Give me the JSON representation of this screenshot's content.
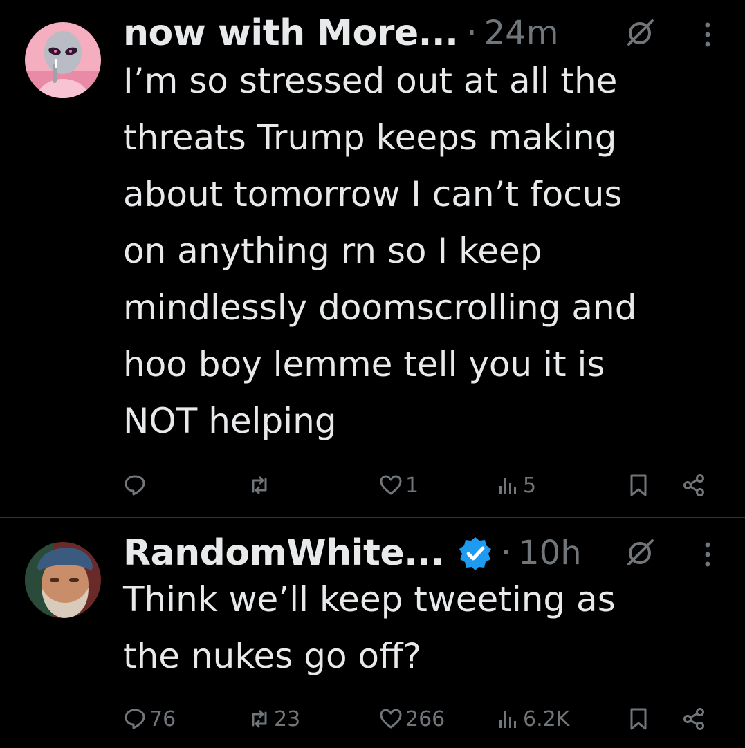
{
  "colors": {
    "background": "#000000",
    "text_primary": "#e7e9ea",
    "text_secondary": "#71767b",
    "divider": "#2f3336",
    "verified_blue": "#1d9bf0"
  },
  "tweets": [
    {
      "display_name": "now with More...",
      "separator": "·",
      "time": "24m",
      "verified": false,
      "avatar_icon": "alien-avatar",
      "text": "I’m so stressed out at all the\nthreats Trump keeps making\nabout tomorrow I can’t focus\non anything rn so I keep\nmindlessly doomscrolling and\nhoo boy lemme tell you it is\nNOT helping",
      "actions": {
        "reply": "",
        "repost": "",
        "like": "1",
        "views": "5"
      }
    },
    {
      "display_name": "RandomWhite...",
      "separator": "·",
      "time": "10h",
      "verified": true,
      "avatar_icon": "bearded-man-avatar",
      "text": "Think we’ll keep tweeting as\nthe nukes go off?",
      "actions": {
        "reply": "76",
        "repost": "23",
        "like": "266",
        "views": "6.2K"
      }
    }
  ]
}
